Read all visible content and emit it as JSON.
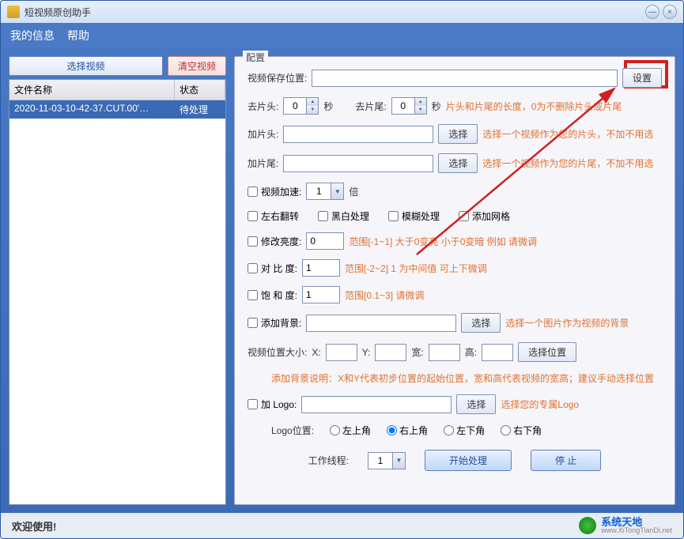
{
  "window": {
    "title": "短视频原创助手"
  },
  "menu": {
    "my_info": "我的信息",
    "help": "帮助"
  },
  "left": {
    "select_video": "选择视频",
    "clear_video": "清空视频",
    "col_filename": "文件名称",
    "col_status": "状态",
    "row_file": "2020-11-03-10-42-37.CUT.00'…",
    "row_status": "待处理"
  },
  "config": {
    "legend": "配置",
    "save_path_label": "视频保存位置:",
    "set_btn": "设置",
    "trim_head_label": "去片头:",
    "trim_head_val": "0",
    "sec": "秒",
    "trim_tail_label": "去片尾:",
    "trim_tail_val": "0",
    "trim_hint": "片头和片尾的长度，0为不删除片头或片尾",
    "add_head_label": "加片头:",
    "choose": "选择",
    "add_head_hint": "选择一个视频作为您的片头，不加不用选",
    "add_tail_label": "加片尾:",
    "add_tail_hint": "选择一个视频作为您的片尾，不加不用选",
    "speed_label": "视频加速:",
    "speed_val": "1",
    "speed_unit": "倍",
    "flip_label": "左右翻转",
    "bw_label": "黑白处理",
    "blur_label": "模糊处理",
    "grid_label": "添加网格",
    "brightness_label": "修改亮度:",
    "brightness_val": "0",
    "brightness_hint": "范围[-1~1]   大于0变亮 小于0变暗  例如 请微调",
    "contrast_label": "对 比  度:",
    "contrast_val": "1",
    "contrast_hint": "范围[-2~2]  1 为中间值  可上下微调",
    "saturation_label": "饱 和  度:",
    "saturation_val": "1",
    "saturation_hint": "范围[0.1~3]   请微调",
    "bg_label": "添加背景:",
    "bg_hint": "选择一个图片作为视频的背景",
    "pos_size_label": "视频位置大小:",
    "x_label": "X:",
    "y_label": "Y:",
    "w_label": "宽:",
    "h_label": "高:",
    "pos_btn": "选择位置",
    "bg_desc": "添加背景说明：X和Y代表初步位置的起始位置，宽和高代表视频的宽高；建议手动选择位置",
    "logo_label": "加 Logo:",
    "logo_hint": "选择您的专属Logo",
    "logo_pos_label": "Logo位置:",
    "pos_tl": "左上角",
    "pos_tr": "右上角",
    "pos_bl": "左下角",
    "pos_br": "右下角",
    "threads_label": "工作线程:",
    "threads_val": "1",
    "start_btn": "开始处理",
    "stop_btn": "停  止"
  },
  "footer": {
    "welcome": "欢迎使用!",
    "brand_cn": "系统天地",
    "brand_en": "www.XiTongTianDi.net"
  }
}
